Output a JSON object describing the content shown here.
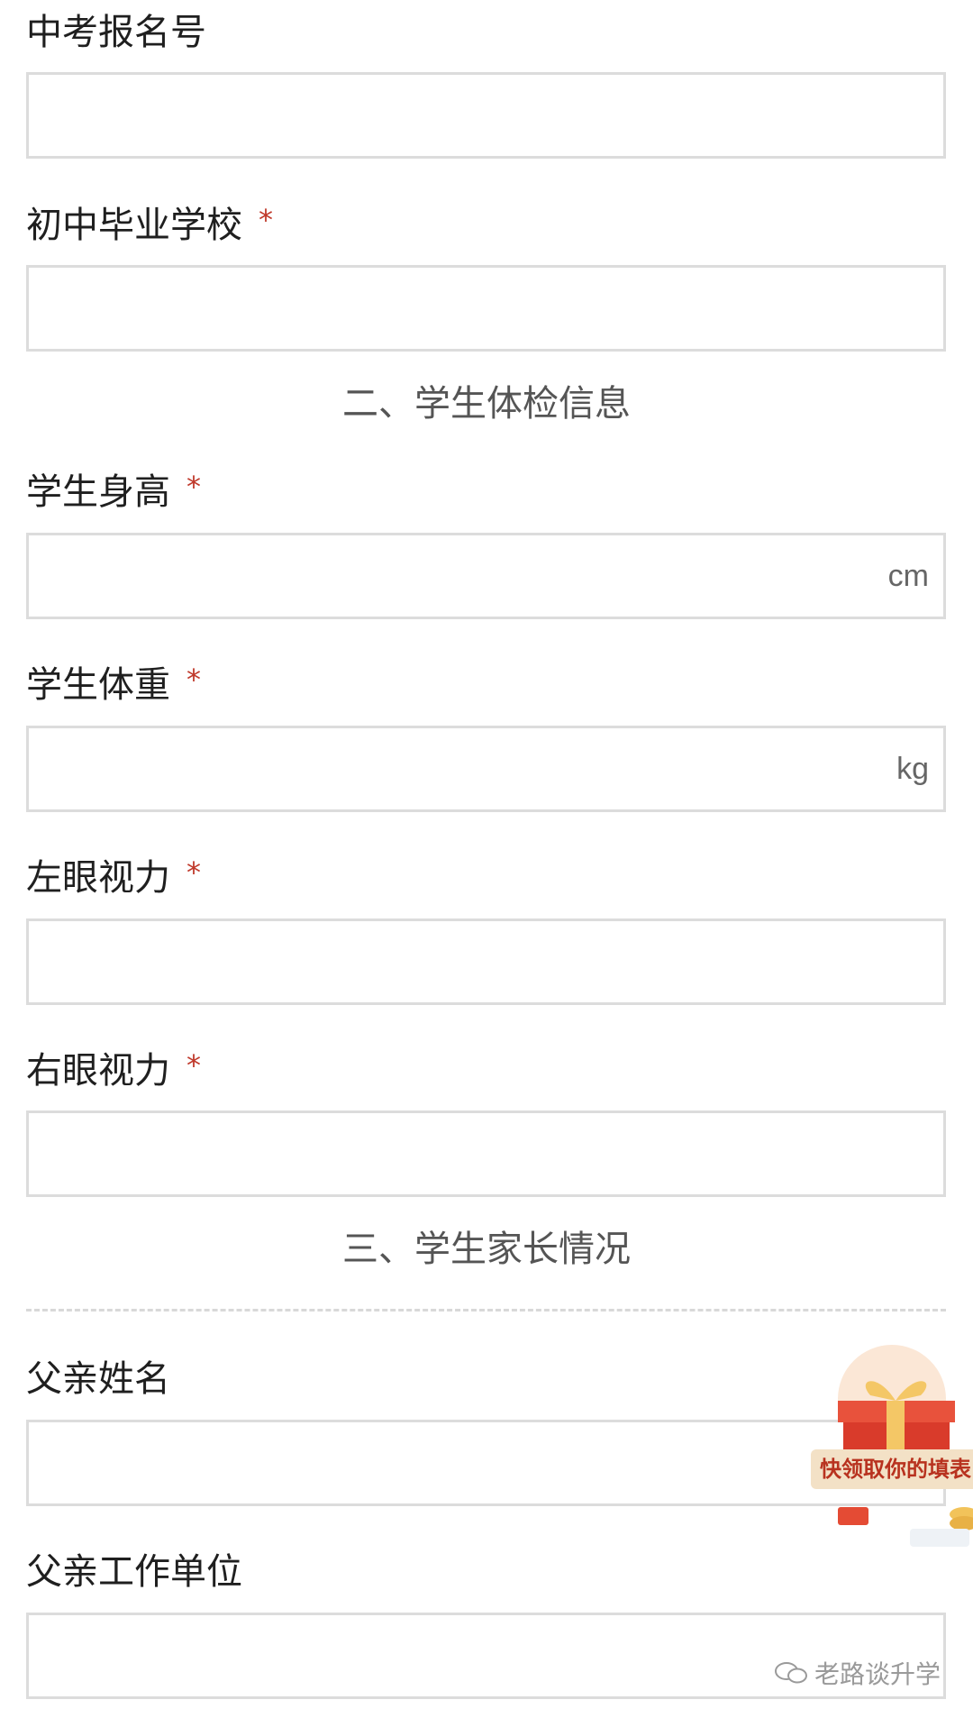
{
  "fields": [
    {
      "label": "中考报名号",
      "required": false,
      "value": "",
      "unit": ""
    },
    {
      "label": "初中毕业学校",
      "required": true,
      "value": "",
      "unit": ""
    },
    {
      "label": "学生身高",
      "required": true,
      "value": "",
      "unit": "cm"
    },
    {
      "label": "学生体重",
      "required": true,
      "value": "",
      "unit": "kg"
    },
    {
      "label": "左眼视力",
      "required": true,
      "value": "",
      "unit": ""
    },
    {
      "label": "右眼视力",
      "required": true,
      "value": "",
      "unit": ""
    },
    {
      "label": "父亲姓名",
      "required": false,
      "value": "",
      "unit": ""
    },
    {
      "label": "父亲工作单位",
      "required": false,
      "value": "",
      "unit": ""
    }
  ],
  "required_mark": "*",
  "sections": {
    "physical_exam": "二、学生体检信息",
    "parents": "三、学生家长情况"
  },
  "promo": {
    "text": "快领取你的填表",
    "icon": "gift-box-icon"
  },
  "watermark": {
    "icon": "wechat-icon",
    "text": "老路谈升学"
  },
  "colors": {
    "required": "#c0392b",
    "border": "#dcdcdc",
    "section_text": "#555555"
  }
}
